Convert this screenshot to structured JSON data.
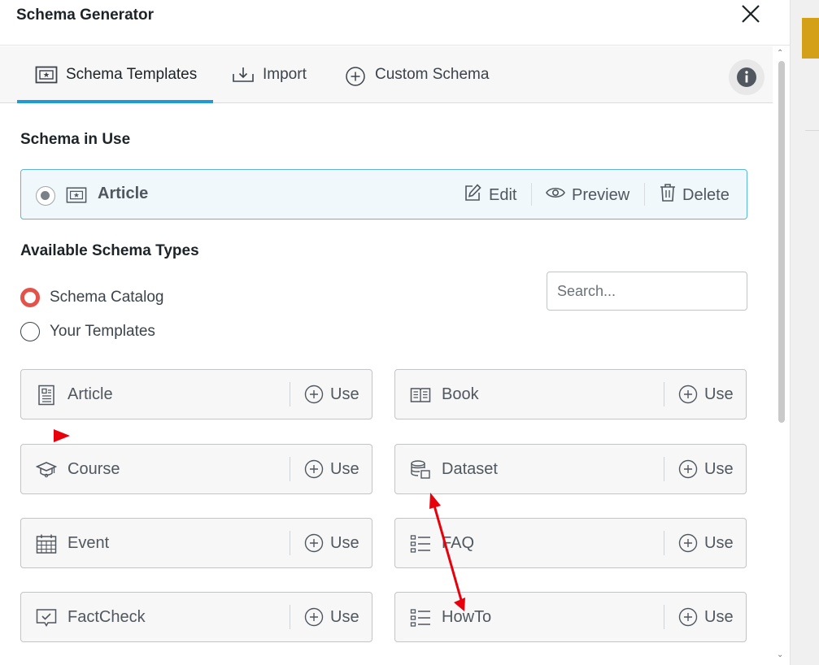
{
  "modal": {
    "title": "Schema Generator"
  },
  "tabs": [
    {
      "label": "Schema Templates",
      "icon": "schema-template-icon",
      "active": true
    },
    {
      "label": "Import",
      "icon": "import-icon",
      "active": false
    },
    {
      "label": "Custom Schema",
      "icon": "plus-circle-icon",
      "active": false
    }
  ],
  "in_use": {
    "heading": "Schema in Use",
    "name": "Article",
    "edit_label": "Edit",
    "preview_label": "Preview",
    "delete_label": "Delete"
  },
  "available": {
    "heading": "Available Schema Types",
    "options": [
      {
        "label": "Schema Catalog",
        "checked": true
      },
      {
        "label": "Your Templates",
        "checked": false
      }
    ],
    "search_placeholder": "Search...",
    "types": [
      {
        "name": "Article",
        "icon": "article-icon",
        "use_label": "Use"
      },
      {
        "name": "Book",
        "icon": "book-icon",
        "use_label": "Use"
      },
      {
        "name": "Course",
        "icon": "graduation-cap-icon",
        "use_label": "Use"
      },
      {
        "name": "Dataset",
        "icon": "database-icon",
        "use_label": "Use"
      },
      {
        "name": "Event",
        "icon": "calendar-icon",
        "use_label": "Use"
      },
      {
        "name": "FAQ",
        "icon": "list-icon",
        "use_label": "Use"
      },
      {
        "name": "FactCheck",
        "icon": "fact-check-icon",
        "use_label": "Use"
      },
      {
        "name": "HowTo",
        "icon": "list-icon",
        "use_label": "Use"
      }
    ]
  },
  "colors": {
    "accent": "#1e9bd7",
    "radio_checked": "#e4534a",
    "annotation": "#e8000b"
  }
}
